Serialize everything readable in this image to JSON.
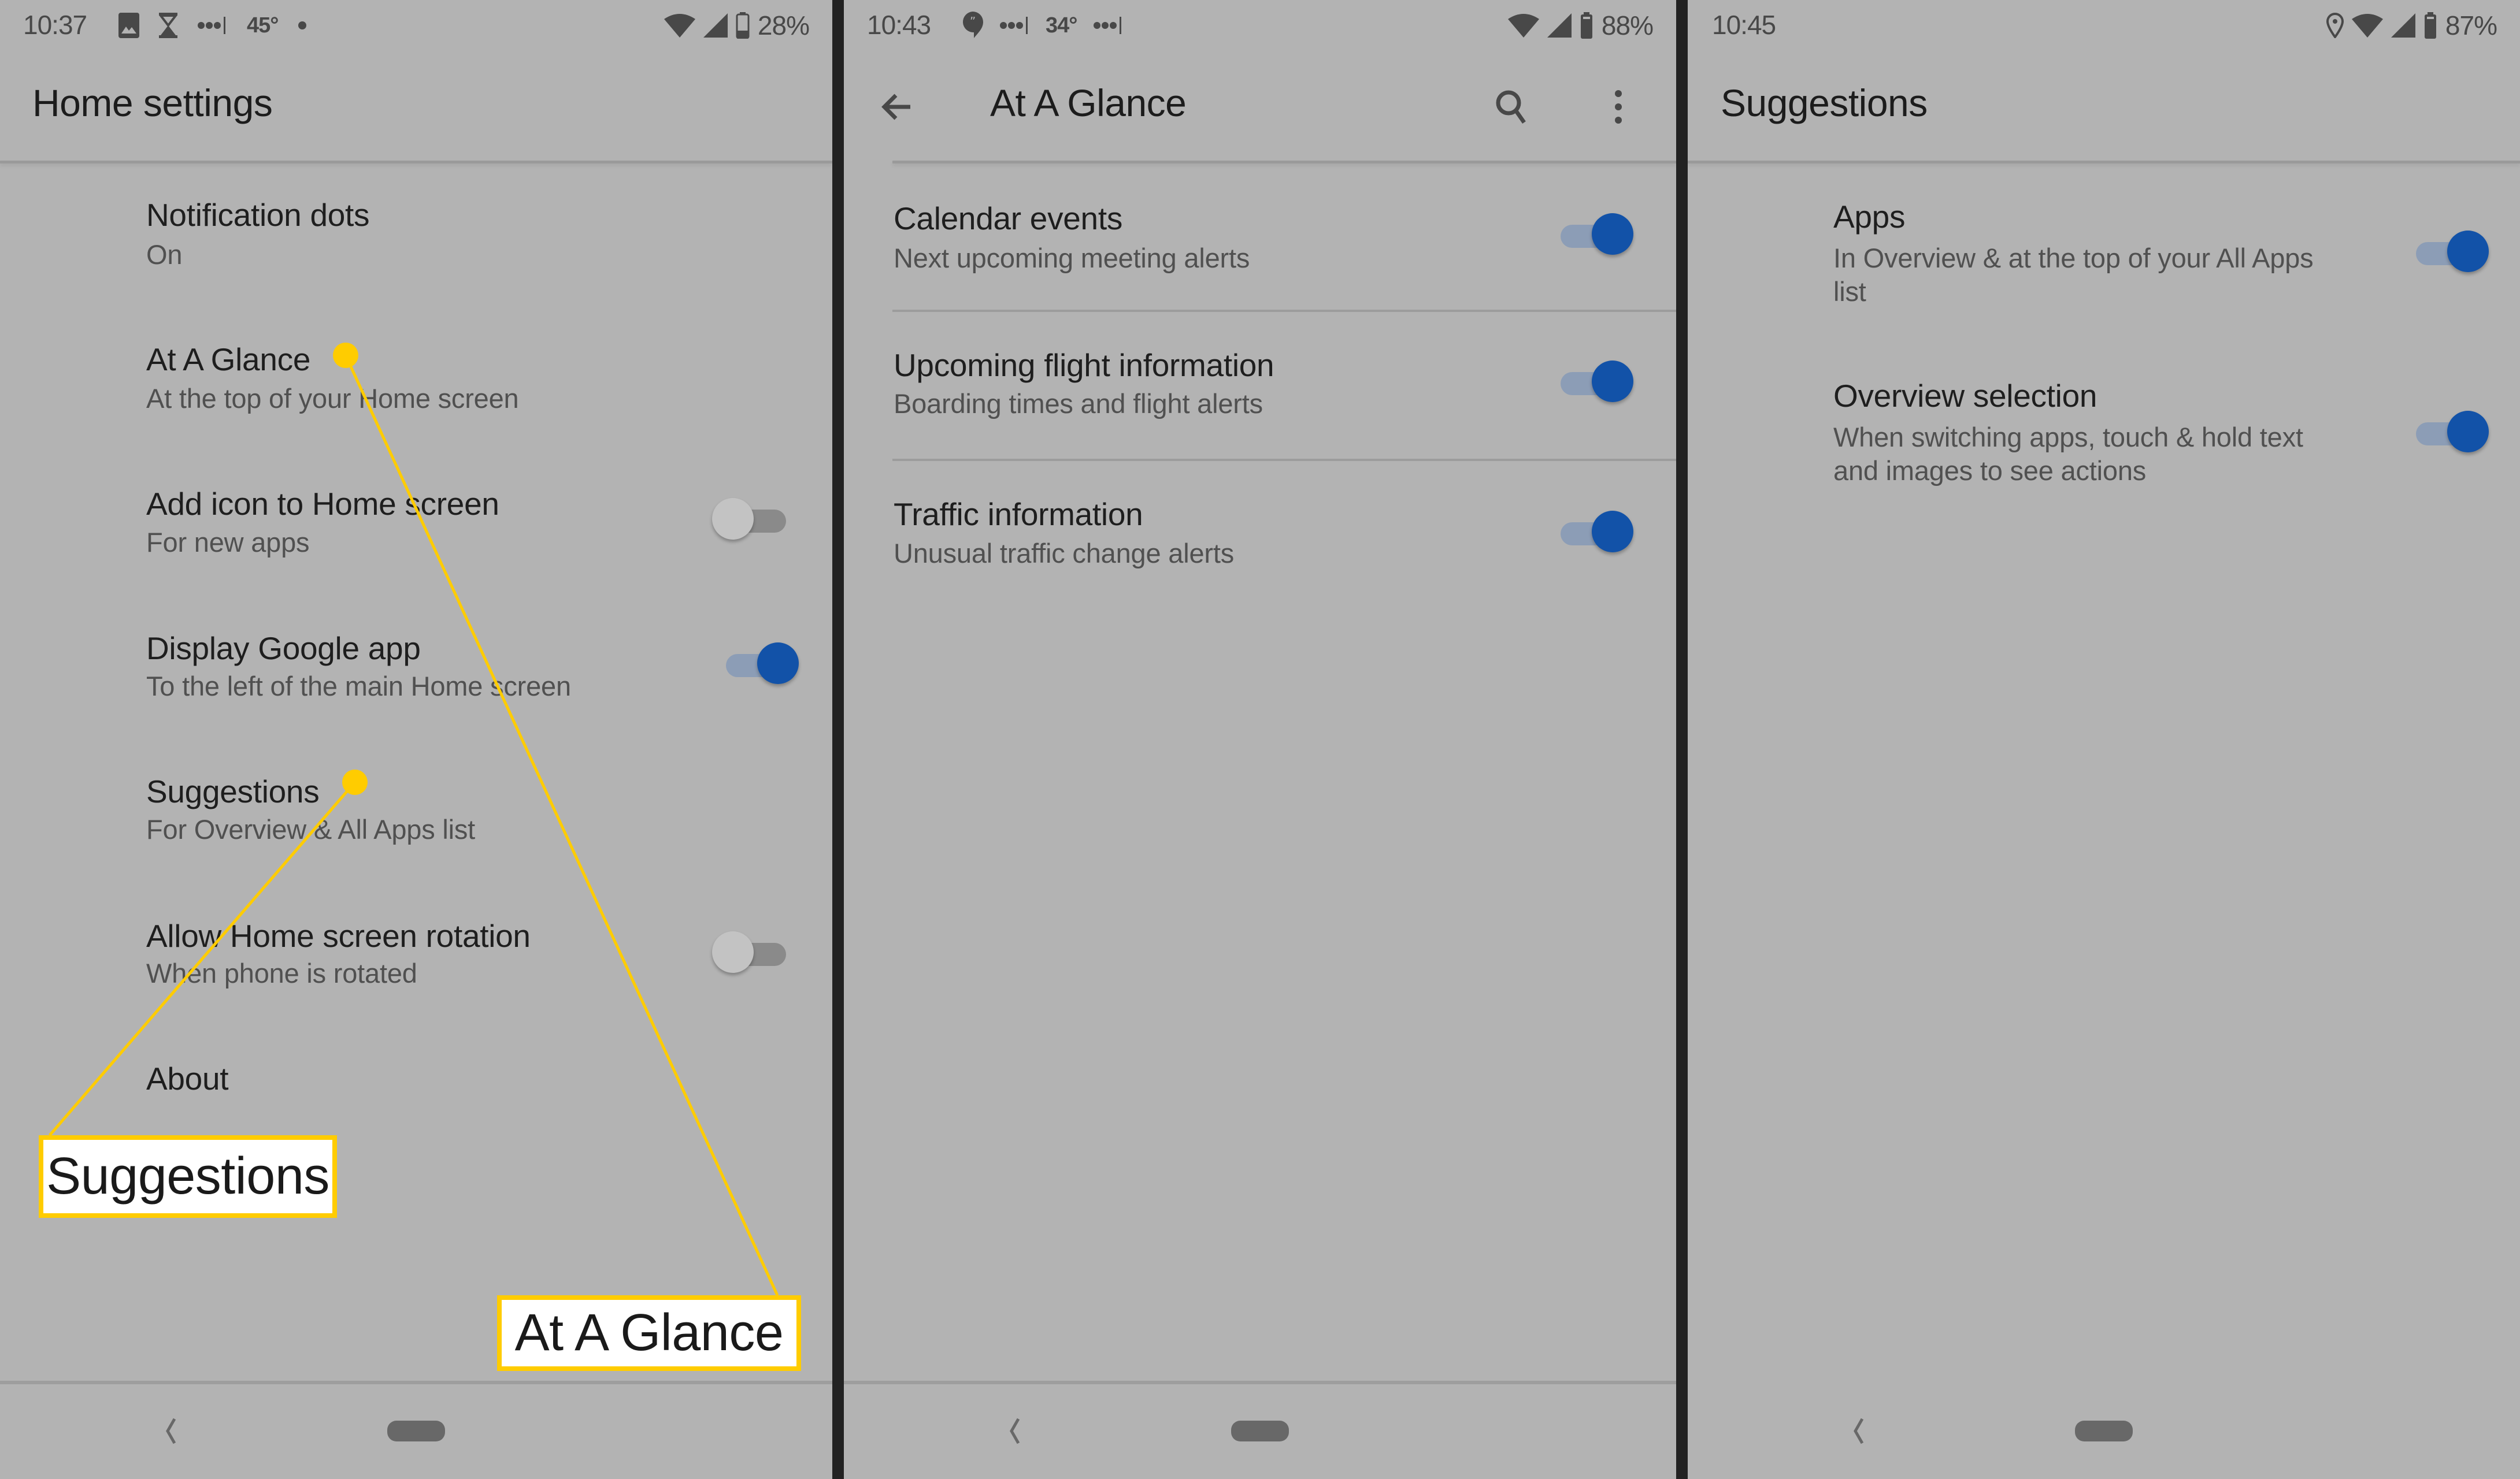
{
  "colors": {
    "background": "#b3b3b3",
    "panel_separator": "#222222",
    "toggle_on_knob": "#1252a8",
    "toggle_on_track": "#8c9db6",
    "toggle_off_knob": "#c3c3c3",
    "toggle_off_track": "#8a8a8a",
    "callout_yellow": "#ffcc00"
  },
  "panels": [
    {
      "status_bar": {
        "time": "10:37",
        "left_icons": [
          "image-icon",
          "hourglass-icon",
          "signal-dots-icon",
          "weather-temp",
          "dot-icon"
        ],
        "temperature": "45°",
        "right_icons": [
          "wifi-icon",
          "cell-signal-icon",
          "battery-icon"
        ],
        "battery": "28%"
      },
      "app_bar": {
        "title": "Home settings"
      },
      "items": [
        {
          "title": "Notification dots",
          "subtitle": "On"
        },
        {
          "title": "At A Glance",
          "subtitle": "At the top of your Home screen"
        },
        {
          "title": "Add icon to Home screen",
          "subtitle": "For new apps",
          "toggle": false
        },
        {
          "title": "Display Google app",
          "subtitle": "To the left of the main Home screen",
          "toggle": true
        },
        {
          "title": "Suggestions",
          "subtitle": "For Overview & All Apps list"
        },
        {
          "title": "Allow Home screen rotation",
          "subtitle": "When phone is rotated",
          "toggle": false
        },
        {
          "title": "About"
        }
      ],
      "callouts": [
        {
          "label": "Suggestions",
          "target": "Suggestions"
        },
        {
          "label": "At A Glance",
          "target": "At A Glance"
        }
      ],
      "nav_bar": [
        "back-icon",
        "home-pill"
      ]
    },
    {
      "status_bar": {
        "time": "10:43",
        "left_icons": [
          "hangouts-icon",
          "signal-dots-icon",
          "weather-temp",
          "signal-dots-icon"
        ],
        "temperature": "34°",
        "right_icons": [
          "wifi-icon",
          "cell-signal-icon",
          "battery-icon"
        ],
        "battery": "88%"
      },
      "app_bar": {
        "title": "At A Glance",
        "back": "back-arrow-icon",
        "actions": [
          "search-icon",
          "more-vert-icon"
        ]
      },
      "items": [
        {
          "title": "Calendar events",
          "subtitle": "Next upcoming meeting alerts",
          "toggle": true
        },
        {
          "title": "Upcoming flight information",
          "subtitle": "Boarding times and flight alerts",
          "toggle": true
        },
        {
          "title": "Traffic information",
          "subtitle": "Unusual traffic change alerts",
          "toggle": true
        }
      ],
      "nav_bar": [
        "back-icon",
        "home-pill"
      ]
    },
    {
      "status_bar": {
        "time": "10:45",
        "right_icons": [
          "location-icon",
          "wifi-icon",
          "cell-signal-icon",
          "battery-icon"
        ],
        "battery": "87%"
      },
      "app_bar": {
        "title": "Suggestions"
      },
      "items": [
        {
          "title": "Apps",
          "subtitle_lines": [
            "In Overview & at the top of your All Apps",
            "list"
          ],
          "toggle": true
        },
        {
          "title": "Overview selection",
          "subtitle_lines": [
            "When switching apps, touch & hold text",
            "and images to see actions"
          ],
          "toggle": true
        }
      ],
      "nav_bar": [
        "back-icon",
        "home-pill"
      ]
    }
  ]
}
